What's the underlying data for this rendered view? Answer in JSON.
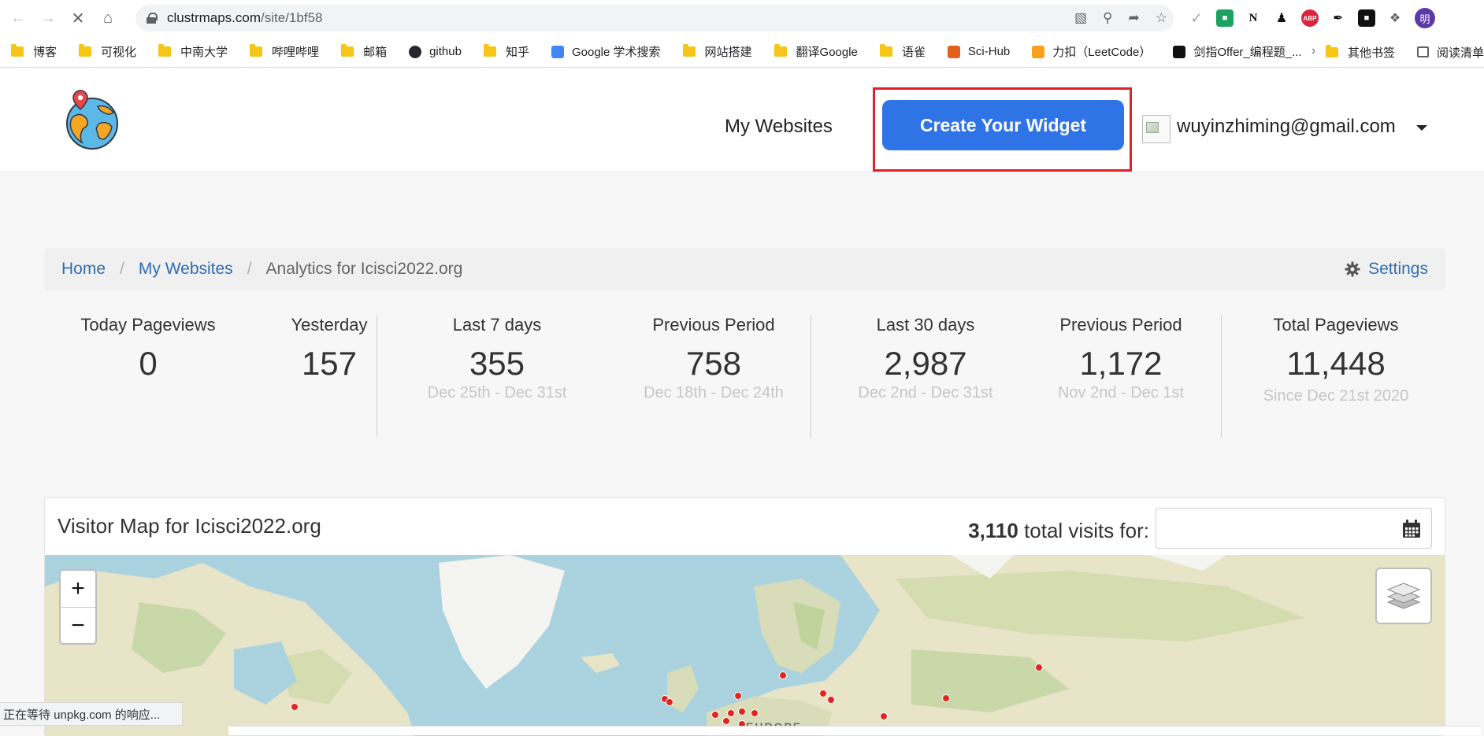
{
  "browser": {
    "url_host": "clustrmaps.com",
    "url_path": "/site/1bf58",
    "profile_initial": "明",
    "bookmarks": [
      {
        "label": "博客",
        "kind": "folder"
      },
      {
        "label": "可视化",
        "kind": "folder"
      },
      {
        "label": "中南大学",
        "kind": "folder"
      },
      {
        "label": "哔哩哔哩",
        "kind": "folder"
      },
      {
        "label": "邮箱",
        "kind": "folder"
      },
      {
        "label": "github",
        "kind": "github"
      },
      {
        "label": "知乎",
        "kind": "folder"
      },
      {
        "label": "Google 学术搜索",
        "kind": "scholar"
      },
      {
        "label": "网站搭建",
        "kind": "folder"
      },
      {
        "label": "翻译Google",
        "kind": "folder"
      },
      {
        "label": "语雀",
        "kind": "folder"
      },
      {
        "label": "Sci-Hub",
        "kind": "scihub"
      },
      {
        "label": "力扣（LeetCode）",
        "kind": "leetcode"
      },
      {
        "label": "剑指Offer_编程题_...",
        "kind": "nowcoder"
      }
    ],
    "bookmarks_more": "»",
    "other_bookmarks": "其他书签",
    "reading_list": "阅读清单",
    "status_text": "正在等待 unpkg.com 的响应..."
  },
  "header": {
    "nav_my_websites": "My Websites",
    "cta_label": "Create Your Widget",
    "user_email": "wuyinzhiming@gmail.com"
  },
  "breadcrumb": {
    "home": "Home",
    "my_websites": "My Websites",
    "current": "Analytics for Icisci2022.org",
    "settings": "Settings"
  },
  "stats": {
    "today": {
      "label": "Today Pageviews",
      "value": "0"
    },
    "yesterday": {
      "label": "Yesterday",
      "value": "157"
    },
    "last7": {
      "label": "Last 7 days",
      "value": "355",
      "range": "Dec 25th - Dec 31st"
    },
    "prev7": {
      "label": "Previous Period",
      "value": "758",
      "range": "Dec 18th - Dec 24th"
    },
    "last30": {
      "label": "Last 30 days",
      "value": "2,987",
      "range": "Dec 2nd - Dec 31st"
    },
    "prev30": {
      "label": "Previous Period",
      "value": "1,172",
      "range": "Nov 2nd - Dec 1st"
    },
    "total": {
      "label": "Total Pageviews",
      "value": "11,448",
      "range": "Since Dec 21st 2020"
    }
  },
  "map": {
    "title": "Visitor Map for Icisci2022.org",
    "total_visits": "3,110",
    "total_visits_suffix": "total visits for:",
    "date_value": "",
    "zoom_in": "+",
    "zoom_out": "−",
    "region_label": "EUROPE"
  },
  "colors": {
    "cta": "#2f74e6",
    "highlight_box": "#e0202a",
    "link": "#2f6cb0",
    "marker": "#e0261f"
  }
}
